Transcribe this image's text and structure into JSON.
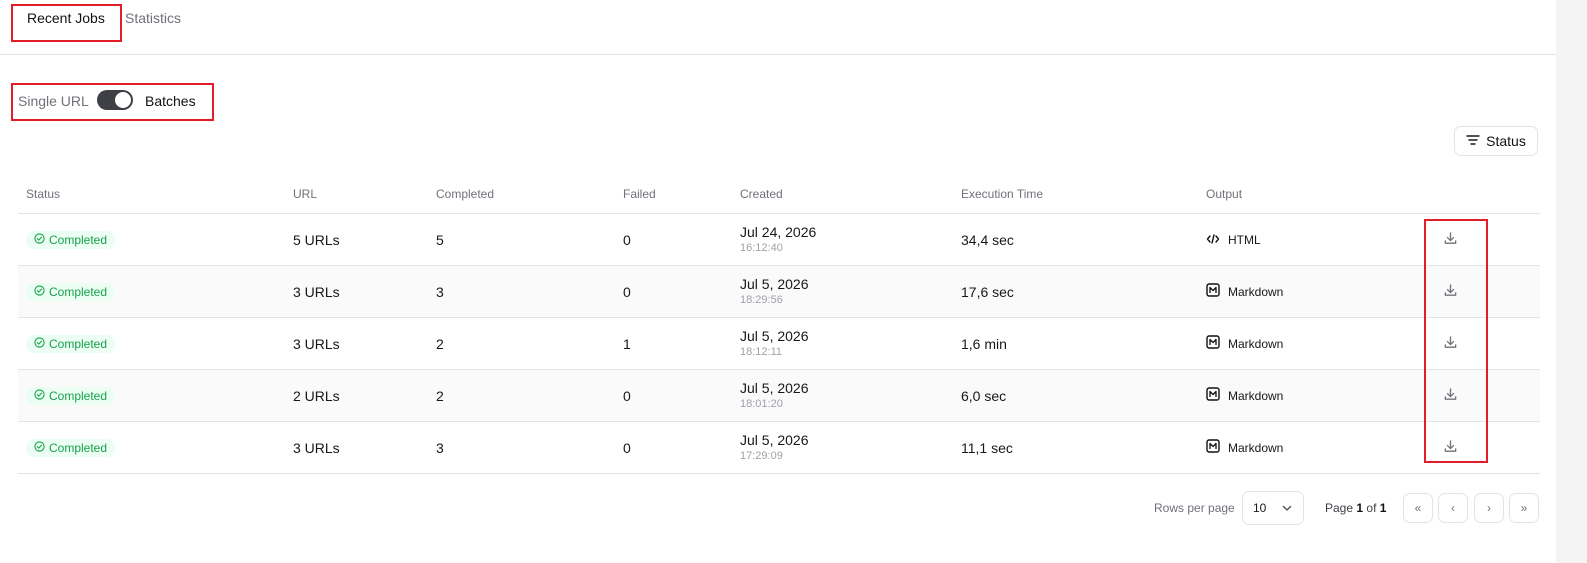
{
  "tabs": [
    {
      "label": "Recent Jobs",
      "active": true
    },
    {
      "label": "Statistics",
      "active": false
    }
  ],
  "mode_toggle": {
    "left_label": "Single URL",
    "right_label": "Batches",
    "checked": true
  },
  "filter": {
    "label": "Status"
  },
  "table": {
    "columns": [
      "Status",
      "URL",
      "Completed",
      "Failed",
      "Created",
      "Execution Time",
      "Output",
      ""
    ],
    "rows": [
      {
        "status": "Completed",
        "url": "5 URLs",
        "completed": "5",
        "failed": "0",
        "date": "Jul 24, 2026",
        "time": "16:12:40",
        "exec": "34,4 sec",
        "output": "HTML",
        "output_icon": "code-icon"
      },
      {
        "status": "Completed",
        "url": "3 URLs",
        "completed": "3",
        "failed": "0",
        "date": "Jul 5, 2026",
        "time": "18:29:56",
        "exec": "17,6 sec",
        "output": "Markdown",
        "output_icon": "markdown-icon"
      },
      {
        "status": "Completed",
        "url": "3 URLs",
        "completed": "2",
        "failed": "1",
        "date": "Jul 5, 2026",
        "time": "18:12:11",
        "exec": "1,6 min",
        "output": "Markdown",
        "output_icon": "markdown-icon"
      },
      {
        "status": "Completed",
        "url": "2 URLs",
        "completed": "2",
        "failed": "0",
        "date": "Jul 5, 2026",
        "time": "18:01:20",
        "exec": "6,0 sec",
        "output": "Markdown",
        "output_icon": "markdown-icon"
      },
      {
        "status": "Completed",
        "url": "3 URLs",
        "completed": "3",
        "failed": "0",
        "date": "Jul 5, 2026",
        "time": "17:29:09",
        "exec": "11,1 sec",
        "output": "Markdown",
        "output_icon": "markdown-icon"
      }
    ]
  },
  "pagination": {
    "rows_per_page_label": "Rows per page",
    "rows_per_page_value": "10",
    "page_label": "Page",
    "current_page": "1",
    "of_label": "of",
    "total_pages": "1",
    "first": "«",
    "prev": "‹",
    "next": "›",
    "last": "»"
  },
  "colors": {
    "accent_green": "#16a34a",
    "badge_bg": "#ecfdf3",
    "highlight_red": "#e11d2a",
    "toggle_dark": "#3f3f46"
  }
}
